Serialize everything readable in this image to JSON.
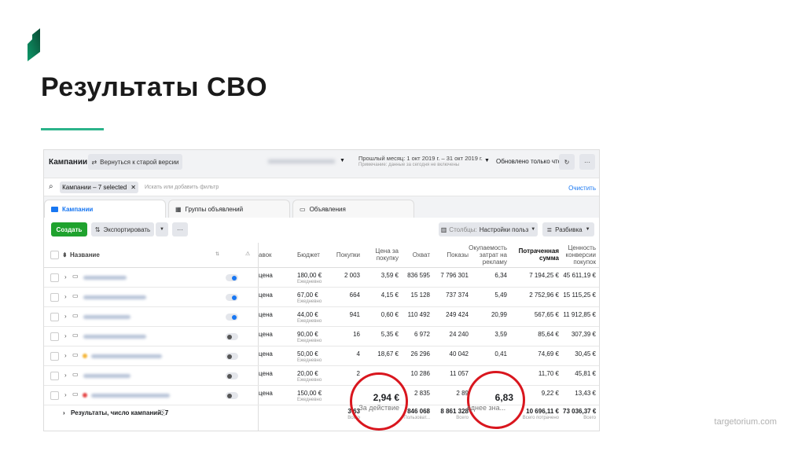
{
  "slide": {
    "title": "Результаты CBO",
    "footer": "targetorium.com"
  },
  "header": {
    "title": "Кампании",
    "revert_label": "Вернуться к старой версии",
    "date_range": "Прошлый месяц: 1 окт 2019 г. – 31 окт 2019 г.",
    "date_note": "Примечание: данные за сегодня не включены",
    "updated": "Обновлено только что",
    "more": "···"
  },
  "filter": {
    "chip": "Кампании – 7 selected",
    "placeholder": "Искать или добавить фильтр",
    "clear": "Очистить"
  },
  "tabs": [
    {
      "label": "Кампании"
    },
    {
      "label": "Группы объявлений"
    },
    {
      "label": "Объявления"
    }
  ],
  "toolbar": {
    "create": "Создать",
    "export": "Экспортировать",
    "more": "···",
    "columns_prefix": "Столбцы:",
    "columns_value": "Настройки польз",
    "breakdown": "Разбивка"
  },
  "columns": {
    "name": "Название",
    "bid": "авок",
    "budget": "Бюджет",
    "purchases": "Покупки",
    "cpp": "Цена за покупку",
    "reach": "Охват",
    "impressions": "Показы",
    "roas": "Окупаемость затрат на рекламу",
    "spent": "Потраченная сумма",
    "value": "Ценность конверсии покупок"
  },
  "rows": [
    {
      "active": true,
      "bid": "цена",
      "budget": "180,00 €",
      "period": "Ежедневно",
      "purchases": "2 003",
      "cpp": "3,59 €",
      "reach": "836 595",
      "impressions": "7 796 301",
      "roas": "6,34",
      "spent": "7 194,25 €",
      "value": "45 611,19 €"
    },
    {
      "active": true,
      "bid": "цена",
      "budget": "67,00 €",
      "period": "Ежедневно",
      "purchases": "664",
      "cpp": "4,15 €",
      "reach": "15 128",
      "impressions": "737 374",
      "roas": "5,49",
      "spent": "2 752,96 €",
      "value": "15 115,25 €"
    },
    {
      "active": true,
      "bid": "цена",
      "budget": "44,00 €",
      "period": "Ежедневно",
      "purchases": "941",
      "cpp": "0,60 €",
      "reach": "110 492",
      "impressions": "249 424",
      "roas": "20,99",
      "spent": "567,65 €",
      "value": "11 912,85 €"
    },
    {
      "active": false,
      "bid": "цена",
      "budget": "90,00 €",
      "period": "Ежедневно",
      "purchases": "16",
      "cpp": "5,35 €",
      "reach": "6 972",
      "impressions": "24 240",
      "roas": "3,59",
      "spent": "85,64 €",
      "value": "307,39 €"
    },
    {
      "active": false,
      "bid": "цена",
      "budget": "50,00 €",
      "period": "Ежедневно",
      "purchases": "4",
      "cpp": "18,67 €",
      "reach": "26 296",
      "impressions": "40 042",
      "roas": "0,41",
      "spent": "74,69 €",
      "value": "30,45 €"
    },
    {
      "active": false,
      "bid": "цена",
      "budget": "20,00 €",
      "period": "Ежедневно",
      "purchases": "2",
      "cpp": "",
      "reach": "10 286",
      "impressions": "11 057",
      "roas": "",
      "spent": "11,70 €",
      "value": "45,81 €"
    },
    {
      "active": false,
      "bid": "цена",
      "budget": "150,00 €",
      "period": "Ежедневно",
      "purchases": "",
      "cpp": "",
      "reach": "2 835",
      "impressions": "2 89",
      "roas": "",
      "spent": "9,22 €",
      "value": "13,43 €"
    }
  ],
  "totals": {
    "label": "Результаты, число кампаний: 7",
    "purchases": "3 63",
    "purchases_sub": "Всего",
    "reach": "846 068",
    "reach_sub": "Пользоват...",
    "impressions": "8 861 328",
    "impressions_sub": "Всего",
    "spent": "10 696,11 €",
    "spent_sub": "Всего потрачено",
    "value": "73 036,37 €",
    "value_sub": "Всего"
  },
  "callouts": [
    {
      "value": "2,94 €",
      "label": "За действие"
    },
    {
      "value": "6,83",
      "label": "еднее зна..."
    }
  ],
  "colors": {
    "accent": "#1877f2",
    "create": "#1fa22e",
    "highlight": "#d9161e",
    "brand": "#2bb38a"
  }
}
